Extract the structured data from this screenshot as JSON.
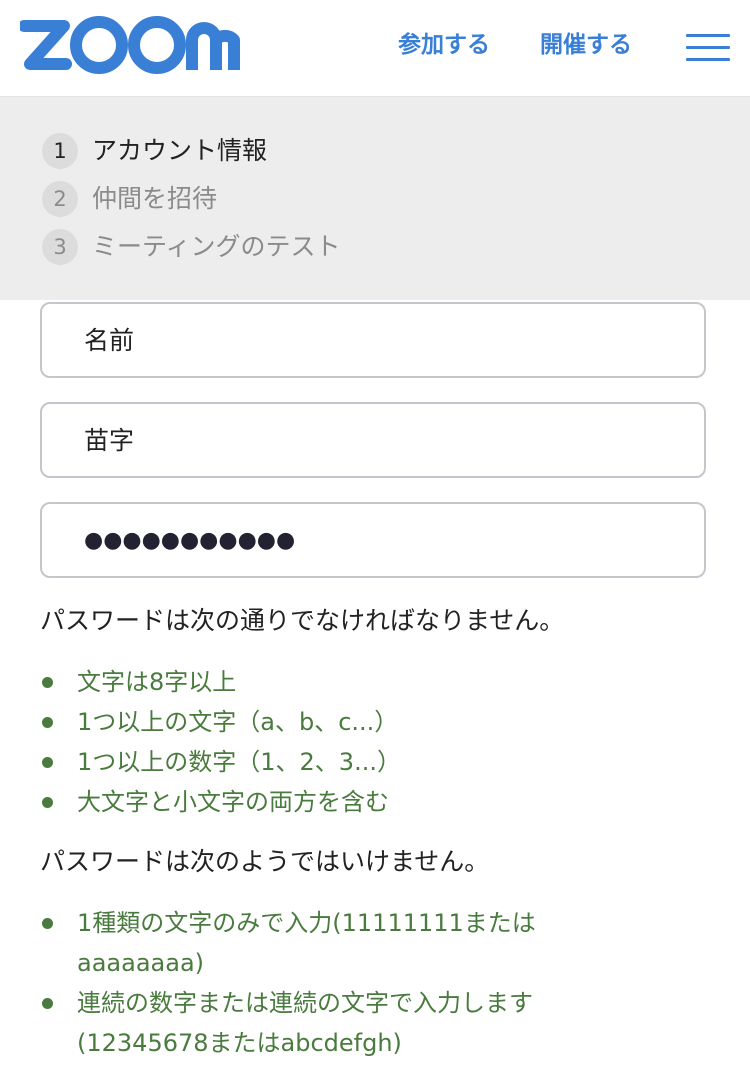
{
  "header": {
    "logo_text": "zoom",
    "nav_join": "参加する",
    "nav_host": "開催する",
    "menu_icon": "hamburger-menu-icon",
    "brand_color": "#3a7fd6"
  },
  "steps": [
    {
      "number": "1",
      "label": "アカウント情報",
      "active": true
    },
    {
      "number": "2",
      "label": "仲間を招待",
      "active": false
    },
    {
      "number": "3",
      "label": "ミーティングのテスト",
      "active": false
    }
  ],
  "form": {
    "first_name": "名前",
    "last_name": "苗字",
    "password_masked": "●●●●●●●●●●●"
  },
  "requirements": {
    "heading": "パスワードは次の通りでなければなりません。",
    "items": [
      "文字は8字以上",
      "1つ以上の文字（a、b、c...）",
      "1つ以上の数字（1、2、3...）",
      "大文字と小文字の両方を含む"
    ]
  },
  "restrictions": {
    "heading": "パスワードは次のようではいけません。",
    "items": [
      "1種類の文字のみで入力(11111111またはaaaaaaaa)",
      "連続の数字または連続の文字で入力します(12345678またはabcdefgh)"
    ]
  },
  "colors": {
    "rule_green": "#4a7b3e",
    "steps_background": "#ededed"
  }
}
